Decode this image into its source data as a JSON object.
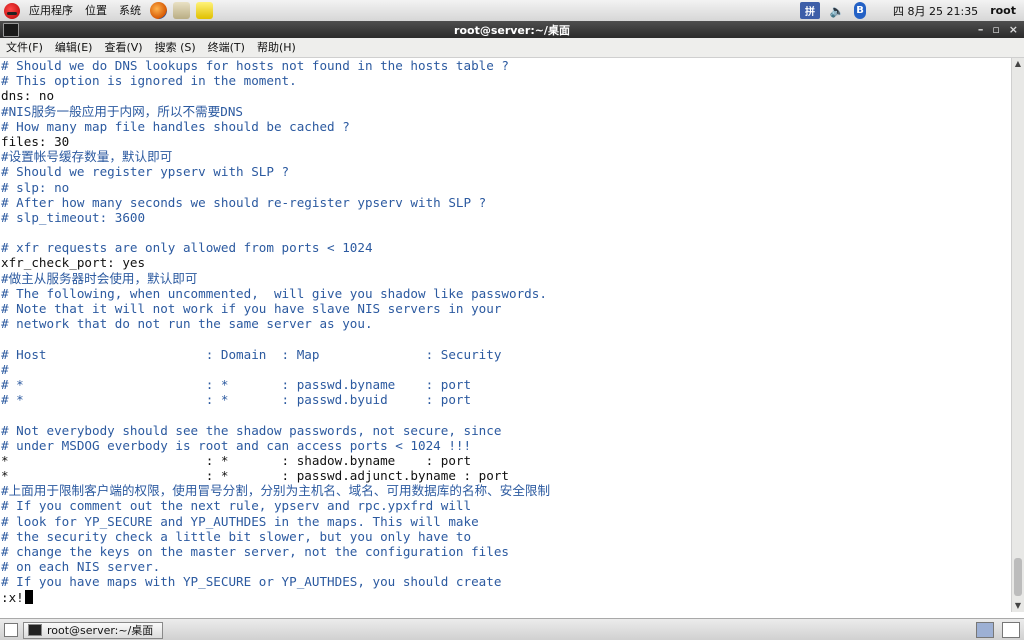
{
  "top_panel": {
    "menus": [
      "应用程序",
      "位置",
      "系统"
    ],
    "tray": {
      "ime": "拼",
      "bluetooth": "B"
    },
    "clock": "四 8月 25 21:35",
    "user": "root"
  },
  "window": {
    "title": "root@server:~/桌面",
    "controls": [
      "–",
      "▫",
      "×"
    ]
  },
  "menubar": [
    "文件(F)",
    "编辑(E)",
    "查看(V)",
    "搜索 (S)",
    "终端(T)",
    "帮助(H)"
  ],
  "terminal": {
    "lines": [
      {
        "text": "# Should we do DNS lookups for hosts not found in the hosts table ?",
        "kind": "comment"
      },
      {
        "text": "# This option is ignored in the moment.",
        "kind": "comment"
      },
      {
        "text": "dns: no",
        "kind": "plain"
      },
      {
        "text": "#NIS服务一般应用于内网，所以不需要DNS",
        "kind": "comment"
      },
      {
        "text": "# How many map file handles should be cached ?",
        "kind": "comment"
      },
      {
        "text": "files: 30",
        "kind": "plain"
      },
      {
        "text": "#设置帐号缓存数量，默认即可",
        "kind": "comment"
      },
      {
        "text": "# Should we register ypserv with SLP ?",
        "kind": "comment"
      },
      {
        "text": "# slp: no",
        "kind": "comment"
      },
      {
        "text": "# After how many seconds we should re-register ypserv with SLP ?",
        "kind": "comment"
      },
      {
        "text": "# slp_timeout: 3600",
        "kind": "comment"
      },
      {
        "text": "",
        "kind": "plain"
      },
      {
        "text": "# xfr requests are only allowed from ports < 1024",
        "kind": "comment"
      },
      {
        "text": "xfr_check_port: yes",
        "kind": "plain"
      },
      {
        "text": "#做主从服务器时会使用，默认即可",
        "kind": "comment"
      },
      {
        "text": "# The following, when uncommented,  will give you shadow like passwords.",
        "kind": "comment"
      },
      {
        "text": "# Note that it will not work if you have slave NIS servers in your",
        "kind": "comment"
      },
      {
        "text": "# network that do not run the same server as you.",
        "kind": "comment"
      },
      {
        "text": "",
        "kind": "plain"
      },
      {
        "text": "# Host                     : Domain  : Map              : Security",
        "kind": "comment"
      },
      {
        "text": "#",
        "kind": "comment"
      },
      {
        "text": "# *                        : *       : passwd.byname    : port",
        "kind": "comment"
      },
      {
        "text": "# *                        : *       : passwd.byuid     : port",
        "kind": "comment"
      },
      {
        "text": "",
        "kind": "plain"
      },
      {
        "text": "# Not everybody should see the shadow passwords, not secure, since",
        "kind": "comment"
      },
      {
        "text": "# under MSDOG everbody is root and can access ports < 1024 !!!",
        "kind": "comment"
      },
      {
        "text": "*                          : *       : shadow.byname    : port",
        "kind": "plain"
      },
      {
        "text": "*                          : *       : passwd.adjunct.byname : port",
        "kind": "plain"
      },
      {
        "text": "#上面用于限制客户端的权限，使用冒号分割，分别为主机名、域名、可用数据库的名称、安全限制",
        "kind": "comment"
      },
      {
        "text": "# If you comment out the next rule, ypserv and rpc.ypxfrd will",
        "kind": "comment"
      },
      {
        "text": "# look for YP_SECURE and YP_AUTHDES in the maps. This will make",
        "kind": "comment"
      },
      {
        "text": "# the security check a little bit slower, but you only have to",
        "kind": "comment"
      },
      {
        "text": "# change the keys on the master server, not the configuration files",
        "kind": "comment"
      },
      {
        "text": "# on each NIS server.",
        "kind": "comment"
      },
      {
        "text": "# If you have maps with YP_SECURE or YP_AUTHDES, you should create",
        "kind": "comment"
      }
    ],
    "command_line": ":x!"
  },
  "taskbar": {
    "task_label": "root@server:~/桌面"
  }
}
